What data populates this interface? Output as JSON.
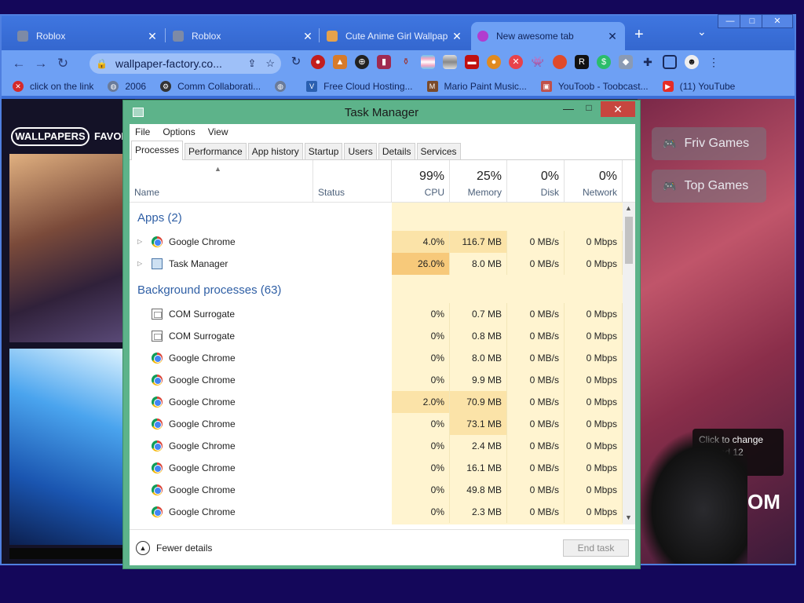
{
  "browser": {
    "tabs": [
      {
        "label": "Roblox",
        "active": false
      },
      {
        "label": "Roblox",
        "active": false
      },
      {
        "label": "Cute Anime Girl Wallpap",
        "active": false
      },
      {
        "label": "New awesome tab",
        "active": true
      }
    ],
    "new_tab": "+",
    "url": "wallpaper-factory.co...",
    "window_controls": {
      "minimize": "—",
      "maximize": "□",
      "close": "✕"
    },
    "bookmarks": [
      {
        "label": "click on the link",
        "icon": "red-x-icon"
      },
      {
        "label": "2006",
        "icon": "globe-icon"
      },
      {
        "label": "Comm Collaborati...",
        "icon": "gear-face-icon"
      },
      {
        "label": "",
        "icon": "globe-icon"
      },
      {
        "label": "Free Cloud Hosting...",
        "icon": "v-logo-icon"
      },
      {
        "label": "Mario Paint Music...",
        "icon": "mario-icon"
      },
      {
        "label": "YouToob - Toobcast...",
        "icon": "youtoob-icon"
      },
      {
        "label": "(11) YouTube",
        "icon": "youtube-icon"
      }
    ]
  },
  "website": {
    "logo": "WALLPAPERS",
    "nav_favorites": "FAVOR",
    "buttons": [
      "Friv Games",
      "Top Games"
    ],
    "tooltip": "Click to change\n...4 and 12\n...s",
    "big_text": "OM"
  },
  "task_manager": {
    "title": "Task Manager",
    "menu": [
      "File",
      "Options",
      "View"
    ],
    "tabs": [
      "Processes",
      "Performance",
      "App history",
      "Startup",
      "Users",
      "Details",
      "Services"
    ],
    "active_tab": "Processes",
    "columns": {
      "name": "Name",
      "status": "Status",
      "cpu": {
        "pct": "99%",
        "label": "CPU"
      },
      "memory": {
        "pct": "25%",
        "label": "Memory"
      },
      "disk": {
        "pct": "0%",
        "label": "Disk"
      },
      "network": {
        "pct": "0%",
        "label": "Network"
      }
    },
    "groups": [
      {
        "label": "Apps (2)",
        "rows": [
          {
            "name": "Google Chrome",
            "icon": "chrome-icon",
            "expandable": true,
            "cpu": "4.0%",
            "memory": "116.7 MB",
            "disk": "0 MB/s",
            "network": "0 Mbps"
          },
          {
            "name": "Task Manager",
            "icon": "task-manager-icon",
            "expandable": true,
            "cpu": "26.0%",
            "memory": "8.0 MB",
            "disk": "0 MB/s",
            "network": "0 Mbps"
          }
        ]
      },
      {
        "label": "Background processes (63)",
        "rows": [
          {
            "name": "COM Surrogate",
            "icon": "com-icon",
            "cpu": "0%",
            "memory": "0.7 MB",
            "disk": "0 MB/s",
            "network": "0 Mbps"
          },
          {
            "name": "COM Surrogate",
            "icon": "com-icon",
            "cpu": "0%",
            "memory": "0.8 MB",
            "disk": "0 MB/s",
            "network": "0 Mbps"
          },
          {
            "name": "Google Chrome",
            "icon": "chrome-icon",
            "cpu": "0%",
            "memory": "8.0 MB",
            "disk": "0 MB/s",
            "network": "0 Mbps"
          },
          {
            "name": "Google Chrome",
            "icon": "chrome-icon",
            "cpu": "0%",
            "memory": "9.9 MB",
            "disk": "0 MB/s",
            "network": "0 Mbps"
          },
          {
            "name": "Google Chrome",
            "icon": "chrome-icon",
            "cpu": "2.0%",
            "memory": "70.9 MB",
            "disk": "0 MB/s",
            "network": "0 Mbps"
          },
          {
            "name": "Google Chrome",
            "icon": "chrome-icon",
            "cpu": "0%",
            "memory": "73.1 MB",
            "disk": "0 MB/s",
            "network": "0 Mbps"
          },
          {
            "name": "Google Chrome",
            "icon": "chrome-icon",
            "cpu": "0%",
            "memory": "2.4 MB",
            "disk": "0 MB/s",
            "network": "0 Mbps"
          },
          {
            "name": "Google Chrome",
            "icon": "chrome-icon",
            "cpu": "0%",
            "memory": "16.1 MB",
            "disk": "0 MB/s",
            "network": "0 Mbps"
          },
          {
            "name": "Google Chrome",
            "icon": "chrome-icon",
            "cpu": "0%",
            "memory": "49.8 MB",
            "disk": "0 MB/s",
            "network": "0 Mbps"
          },
          {
            "name": "Google Chrome",
            "icon": "chrome-icon",
            "cpu": "0%",
            "memory": "2.3 MB",
            "disk": "0 MB/s",
            "network": "0 Mbps"
          }
        ]
      }
    ],
    "footer": {
      "fewer_details": "Fewer details",
      "end_task": "End task"
    },
    "colors": {
      "accent": "#5db38a",
      "cpu_high": "#f7c97a",
      "cpu_mid": "#fbe3a8",
      "cell_tint": "#fff4d0",
      "group_text": "#2f5fa5"
    }
  }
}
